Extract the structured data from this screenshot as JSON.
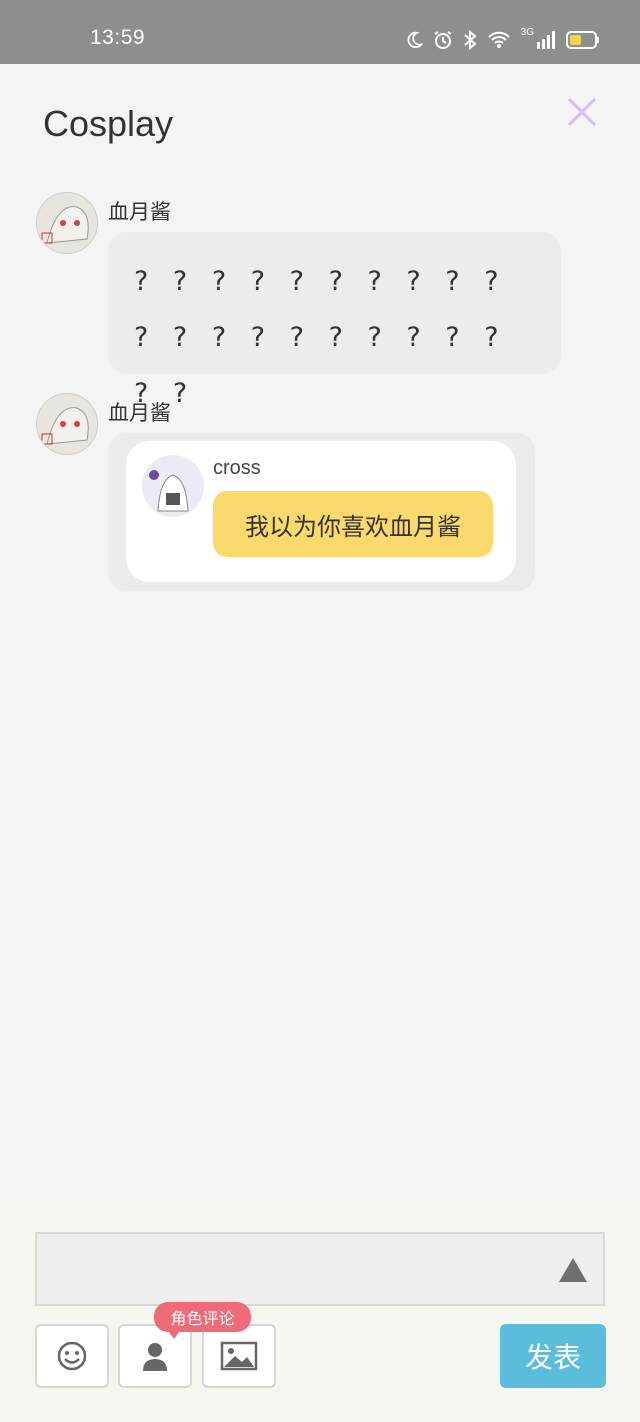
{
  "status_bar": {
    "time": "13:59",
    "network_label": "3G",
    "icons": [
      "moon-icon",
      "alarm-icon",
      "bluetooth-icon",
      "wifi-icon",
      "signal-icon",
      "battery-icon"
    ],
    "battery_color": "#f2d14e"
  },
  "header": {
    "title": "Cosplay",
    "close_icon": "close-icon",
    "close_color": "#d6bdf2"
  },
  "messages": [
    {
      "author": "血月酱",
      "text": "? ? ? ? ? ? ? ? ? ? ? ? ? ? ? ? ? ? ? ? ? ?"
    },
    {
      "author": "血月酱",
      "quote": {
        "name": "cross",
        "text": "我以为你喜欢血月酱"
      }
    }
  ],
  "composer": {
    "input_value": "",
    "role_tag": "角色评论",
    "publish_label": "发表",
    "publish_color": "#5bbddc",
    "tools": [
      "emoji-icon",
      "user-icon",
      "image-icon"
    ]
  }
}
